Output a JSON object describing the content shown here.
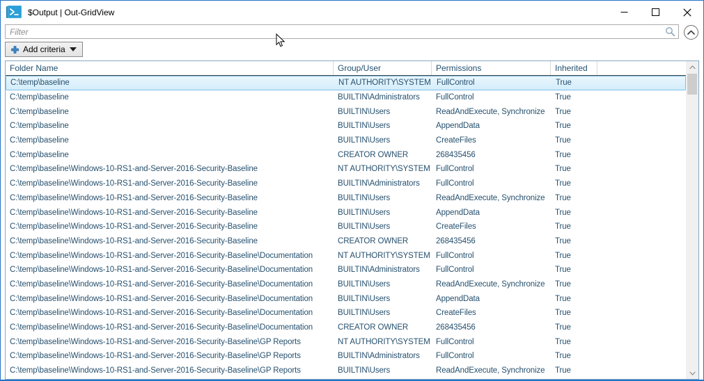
{
  "window": {
    "title": "$Output | Out-GridView",
    "app_icon": "powershell-icon",
    "controls": {
      "minimize": "minimize-icon",
      "maximize": "maximize-icon",
      "close": "close-icon"
    }
  },
  "filter": {
    "placeholder": "Filter",
    "search_icon": "search-icon",
    "collapse_icon": "chevron-up-circle-icon"
  },
  "toolbar": {
    "add_criteria_label": "Add criteria",
    "plus_icon": "plus-icon",
    "dropdown_icon": "caret-down-icon"
  },
  "colors": {
    "window_border": "#2473c8",
    "selection_fill": "#d3edfb",
    "selection_border": "#7dc1e8",
    "accent_plus": "#3c86c6",
    "row_text": "#26506e"
  },
  "table": {
    "columns": [
      "Folder Name",
      "Group/User",
      "Permissions",
      "Inherited"
    ],
    "selected_row_index": 0,
    "rows": [
      [
        "C:\\temp\\baseline",
        "NT AUTHORITY\\SYSTEM",
        "FullControl",
        "True"
      ],
      [
        "C:\\temp\\baseline",
        "BUILTIN\\Administrators",
        "FullControl",
        "True"
      ],
      [
        "C:\\temp\\baseline",
        "BUILTIN\\Users",
        "ReadAndExecute, Synchronize",
        "True"
      ],
      [
        "C:\\temp\\baseline",
        "BUILTIN\\Users",
        "AppendData",
        "True"
      ],
      [
        "C:\\temp\\baseline",
        "BUILTIN\\Users",
        "CreateFiles",
        "True"
      ],
      [
        "C:\\temp\\baseline",
        "CREATOR OWNER",
        "268435456",
        "True"
      ],
      [
        "C:\\temp\\baseline\\Windows-10-RS1-and-Server-2016-Security-Baseline",
        "NT AUTHORITY\\SYSTEM",
        "FullControl",
        "True"
      ],
      [
        "C:\\temp\\baseline\\Windows-10-RS1-and-Server-2016-Security-Baseline",
        "BUILTIN\\Administrators",
        "FullControl",
        "True"
      ],
      [
        "C:\\temp\\baseline\\Windows-10-RS1-and-Server-2016-Security-Baseline",
        "BUILTIN\\Users",
        "ReadAndExecute, Synchronize",
        "True"
      ],
      [
        "C:\\temp\\baseline\\Windows-10-RS1-and-Server-2016-Security-Baseline",
        "BUILTIN\\Users",
        "AppendData",
        "True"
      ],
      [
        "C:\\temp\\baseline\\Windows-10-RS1-and-Server-2016-Security-Baseline",
        "BUILTIN\\Users",
        "CreateFiles",
        "True"
      ],
      [
        "C:\\temp\\baseline\\Windows-10-RS1-and-Server-2016-Security-Baseline",
        "CREATOR OWNER",
        "268435456",
        "True"
      ],
      [
        "C:\\temp\\baseline\\Windows-10-RS1-and-Server-2016-Security-Baseline\\Documentation",
        "NT AUTHORITY\\SYSTEM",
        "FullControl",
        "True"
      ],
      [
        "C:\\temp\\baseline\\Windows-10-RS1-and-Server-2016-Security-Baseline\\Documentation",
        "BUILTIN\\Administrators",
        "FullControl",
        "True"
      ],
      [
        "C:\\temp\\baseline\\Windows-10-RS1-and-Server-2016-Security-Baseline\\Documentation",
        "BUILTIN\\Users",
        "ReadAndExecute, Synchronize",
        "True"
      ],
      [
        "C:\\temp\\baseline\\Windows-10-RS1-and-Server-2016-Security-Baseline\\Documentation",
        "BUILTIN\\Users",
        "AppendData",
        "True"
      ],
      [
        "C:\\temp\\baseline\\Windows-10-RS1-and-Server-2016-Security-Baseline\\Documentation",
        "BUILTIN\\Users",
        "CreateFiles",
        "True"
      ],
      [
        "C:\\temp\\baseline\\Windows-10-RS1-and-Server-2016-Security-Baseline\\Documentation",
        "CREATOR OWNER",
        "268435456",
        "True"
      ],
      [
        "C:\\temp\\baseline\\Windows-10-RS1-and-Server-2016-Security-Baseline\\GP Reports",
        "NT AUTHORITY\\SYSTEM",
        "FullControl",
        "True"
      ],
      [
        "C:\\temp\\baseline\\Windows-10-RS1-and-Server-2016-Security-Baseline\\GP Reports",
        "BUILTIN\\Administrators",
        "FullControl",
        "True"
      ],
      [
        "C:\\temp\\baseline\\Windows-10-RS1-and-Server-2016-Security-Baseline\\GP Reports",
        "BUILTIN\\Users",
        "ReadAndExecute, Synchronize",
        "True"
      ]
    ]
  }
}
